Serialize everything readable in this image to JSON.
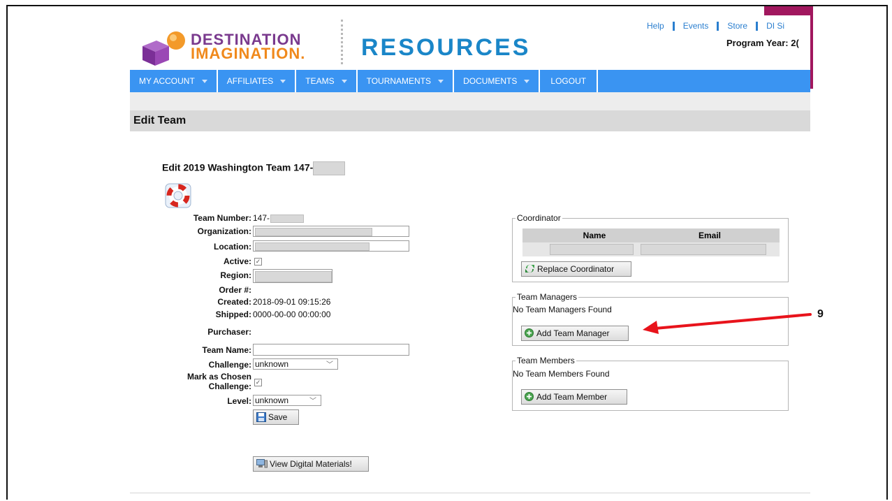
{
  "header": {
    "logo_line1": "DESTINATION",
    "logo_line2": "IMAGINATION.",
    "site_title": "RESOURCES",
    "links": [
      "Help",
      "Events",
      "Store",
      "DI Si"
    ],
    "program_year": "Program Year: 2("
  },
  "nav": [
    "MY ACCOUNT",
    "AFFILIATES",
    "TEAMS",
    "TOURNAMENTS",
    "DOCUMENTS",
    "LOGOUT"
  ],
  "page": {
    "section_title": "Edit Team",
    "edit_heading": "Edit 2019 Washington Team 147-"
  },
  "form": {
    "team_number_label": "Team Number:",
    "team_number_value": "147-",
    "organization_label": "Organization:",
    "location_label": "Location:",
    "active_label": "Active:",
    "region_label": "Region:",
    "order_label": "Order #:",
    "created_label": "Created:",
    "created_value": "2018-09-01 09:15:26",
    "shipped_label": "Shipped:",
    "shipped_value": "0000-00-00 00:00:00",
    "purchaser_label": "Purchaser:",
    "team_name_label": "Team Name:",
    "challenge_label": "Challenge:",
    "challenge_value": "unknown",
    "mark_label_1": "Mark as Chosen",
    "mark_label_2": "Challenge:",
    "level_label": "Level:",
    "level_value": "unknown",
    "save_label": "Save",
    "digital_label": "View Digital Materials!"
  },
  "coordinator": {
    "legend": "Coordinator",
    "col_name": "Name",
    "col_email": "Email",
    "replace_label": "Replace Coordinator"
  },
  "managers": {
    "legend": "Team Managers",
    "empty": "No Team Managers Found",
    "add_label": "Add Team Manager"
  },
  "members": {
    "legend": "Team Members",
    "empty": "No Team Members Found",
    "add_label": "Add Team Member"
  },
  "annotation": {
    "number": "9",
    "arrow_color": "#e8131b"
  },
  "colors": {
    "nav_bg": "#3a94f2",
    "accent_magenta": "#a1175e",
    "resources_blue": "#1a86c8"
  }
}
